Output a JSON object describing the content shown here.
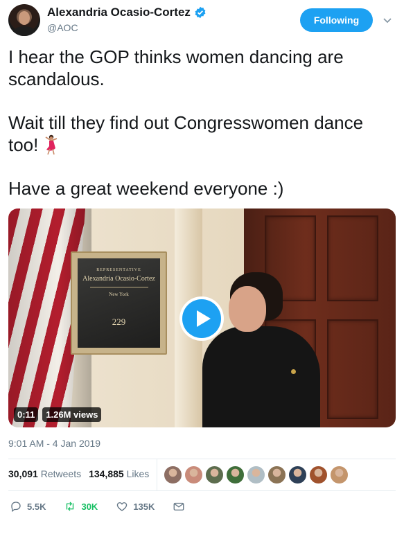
{
  "author": {
    "display_name": "Alexandria Ocasio-Cortez",
    "handle": "@AOC",
    "verified": true
  },
  "follow_button": {
    "label": "Following"
  },
  "tweet": {
    "paragraphs": [
      "I hear the GOP thinks women dancing are scandalous.",
      "Wait till they find out Congresswomen dance too!",
      "Have a great weekend everyone :)"
    ],
    "emoji": "dancer-emoji"
  },
  "media": {
    "plaque": {
      "title": "REPRESENTATIVE",
      "name": "Alexandria Ocasio-Cortez",
      "state": "New York",
      "room": "229"
    },
    "duration": "0:11",
    "views": "1.26M views"
  },
  "timestamp": "9:01 AM - 4 Jan 2019",
  "stats": {
    "retweets_count": "30,091",
    "retweets_label": "Retweets",
    "likes_count": "134,885",
    "likes_label": "Likes"
  },
  "liker_avatars": [
    "#8d6e63",
    "#c98b7a",
    "#5d6d4e",
    "#3f6e3a",
    "#b0bec5",
    "#8b7355",
    "#2e4057",
    "#a0522d",
    "#c4956c"
  ],
  "actions": {
    "replies": "5.5K",
    "retweets": "30K",
    "likes": "135K"
  },
  "colors": {
    "accent": "#1da1f2",
    "retweet_green": "#17bf63",
    "muted_text": "#657786"
  }
}
